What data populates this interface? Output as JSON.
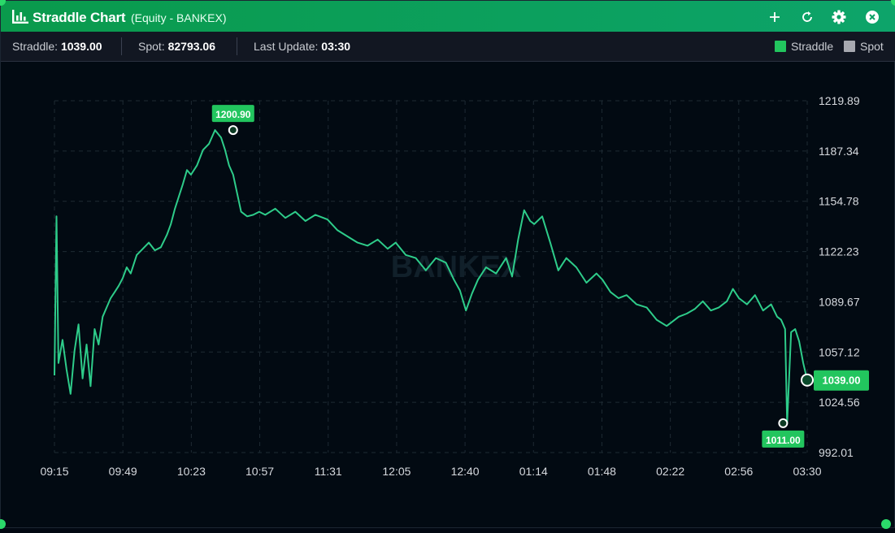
{
  "window": {
    "title": "Straddle Chart",
    "subtitle": "(Equity - BANKEX)",
    "icons": [
      "bar-chart-icon",
      "plus-icon",
      "refresh-icon",
      "gear-icon",
      "close-icon"
    ]
  },
  "info": {
    "straddle_label": "Straddle:",
    "straddle_value": "1039.00",
    "spot_label": "Spot:",
    "spot_value": "82793.06",
    "update_label": "Last Update:",
    "update_value": "03:30"
  },
  "legend": {
    "straddle": "Straddle",
    "spot": "Spot",
    "straddle_color": "#22c55e",
    "spot_color": "#a7a9b0"
  },
  "watermark": "BANKEX",
  "colors": {
    "accent": "#0aa05a",
    "line": "#2ecc8a",
    "background": "#020a12"
  },
  "chart_data": {
    "type": "line",
    "x_ticks": [
      "09:15",
      "09:49",
      "10:23",
      "10:57",
      "11:31",
      "12:05",
      "12:40",
      "01:14",
      "01:48",
      "02:22",
      "02:56",
      "03:30"
    ],
    "y_ticks": [
      "1219.89",
      "1187.34",
      "1154.78",
      "1122.23",
      "1089.67",
      "1057.12",
      "1024.56",
      "992.01"
    ],
    "ylim": [
      992.01,
      1219.89
    ],
    "grid": true,
    "series": [
      {
        "name": "Straddle",
        "x": [
          "09:15",
          "09:16",
          "09:17",
          "09:19",
          "09:21",
          "09:23",
          "09:25",
          "09:27",
          "09:29",
          "09:31",
          "09:33",
          "09:35",
          "09:37",
          "09:39",
          "09:41",
          "09:43",
          "09:45",
          "09:47",
          "09:49",
          "09:51",
          "09:53",
          "09:56",
          "09:59",
          "10:02",
          "10:05",
          "10:08",
          "10:11",
          "10:13",
          "10:15",
          "10:17",
          "10:19",
          "10:21",
          "10:23",
          "10:26",
          "10:29",
          "10:32",
          "10:35",
          "10:38",
          "10:40",
          "10:42",
          "10:44",
          "10:46",
          "10:48",
          "10:51",
          "10:54",
          "10:57",
          "11:00",
          "11:05",
          "11:10",
          "11:15",
          "11:20",
          "11:25",
          "11:31",
          "11:36",
          "11:41",
          "11:46",
          "11:51",
          "11:56",
          "12:01",
          "12:05",
          "12:10",
          "12:15",
          "12:20",
          "12:25",
          "12:30",
          "12:34",
          "12:37",
          "12:40",
          "12:43",
          "12:46",
          "12:50",
          "12:55",
          "01:00",
          "01:03",
          "01:06",
          "01:09",
          "01:12",
          "01:14",
          "01:18",
          "01:22",
          "01:26",
          "01:30",
          "01:35",
          "01:40",
          "01:45",
          "01:48",
          "01:52",
          "01:56",
          "02:00",
          "02:05",
          "02:10",
          "02:15",
          "02:20",
          "02:22",
          "02:26",
          "02:30",
          "02:34",
          "02:38",
          "02:42",
          "02:46",
          "02:50",
          "02:53",
          "02:56",
          "03:00",
          "03:04",
          "03:08",
          "03:12",
          "03:15",
          "03:17",
          "03:18",
          "03:19",
          "03:20",
          "03:22",
          "03:24",
          "03:26",
          "03:28",
          "03:30"
        ],
        "y": [
          1042,
          1145,
          1050,
          1065,
          1046,
          1030,
          1058,
          1075,
          1040,
          1062,
          1035,
          1072,
          1062,
          1080,
          1086,
          1092,
          1096,
          1100,
          1105,
          1112,
          1108,
          1120,
          1124,
          1128,
          1123,
          1125,
          1133,
          1140,
          1150,
          1158,
          1166,
          1175,
          1172,
          1178,
          1188,
          1192,
          1200.9,
          1196,
          1188,
          1178,
          1172,
          1160,
          1148,
          1145,
          1146,
          1148,
          1146,
          1150,
          1144,
          1148,
          1142,
          1146,
          1143,
          1136,
          1132,
          1128,
          1126,
          1130,
          1124,
          1128,
          1120,
          1118,
          1110,
          1118,
          1115,
          1104,
          1097,
          1084,
          1095,
          1104,
          1112,
          1108,
          1118,
          1106,
          1130,
          1149,
          1142,
          1140,
          1145,
          1128,
          1110,
          1118,
          1112,
          1102,
          1108,
          1104,
          1096,
          1092,
          1094,
          1088,
          1086,
          1078,
          1074,
          1076,
          1080,
          1082,
          1085,
          1090,
          1084,
          1086,
          1090,
          1098,
          1092,
          1088,
          1094,
          1084,
          1088,
          1080,
          1078,
          1075,
          1072,
          1011,
          1070,
          1072,
          1064,
          1050,
          1039
        ]
      }
    ],
    "annotations": [
      {
        "label": "1200.90",
        "x": "10:44",
        "y": 1200.9
      },
      {
        "label": "1011.00",
        "x": "03:18",
        "y": 1011.0
      },
      {
        "label": "1039.00",
        "x": "03:30",
        "y": 1039.0
      }
    ]
  }
}
